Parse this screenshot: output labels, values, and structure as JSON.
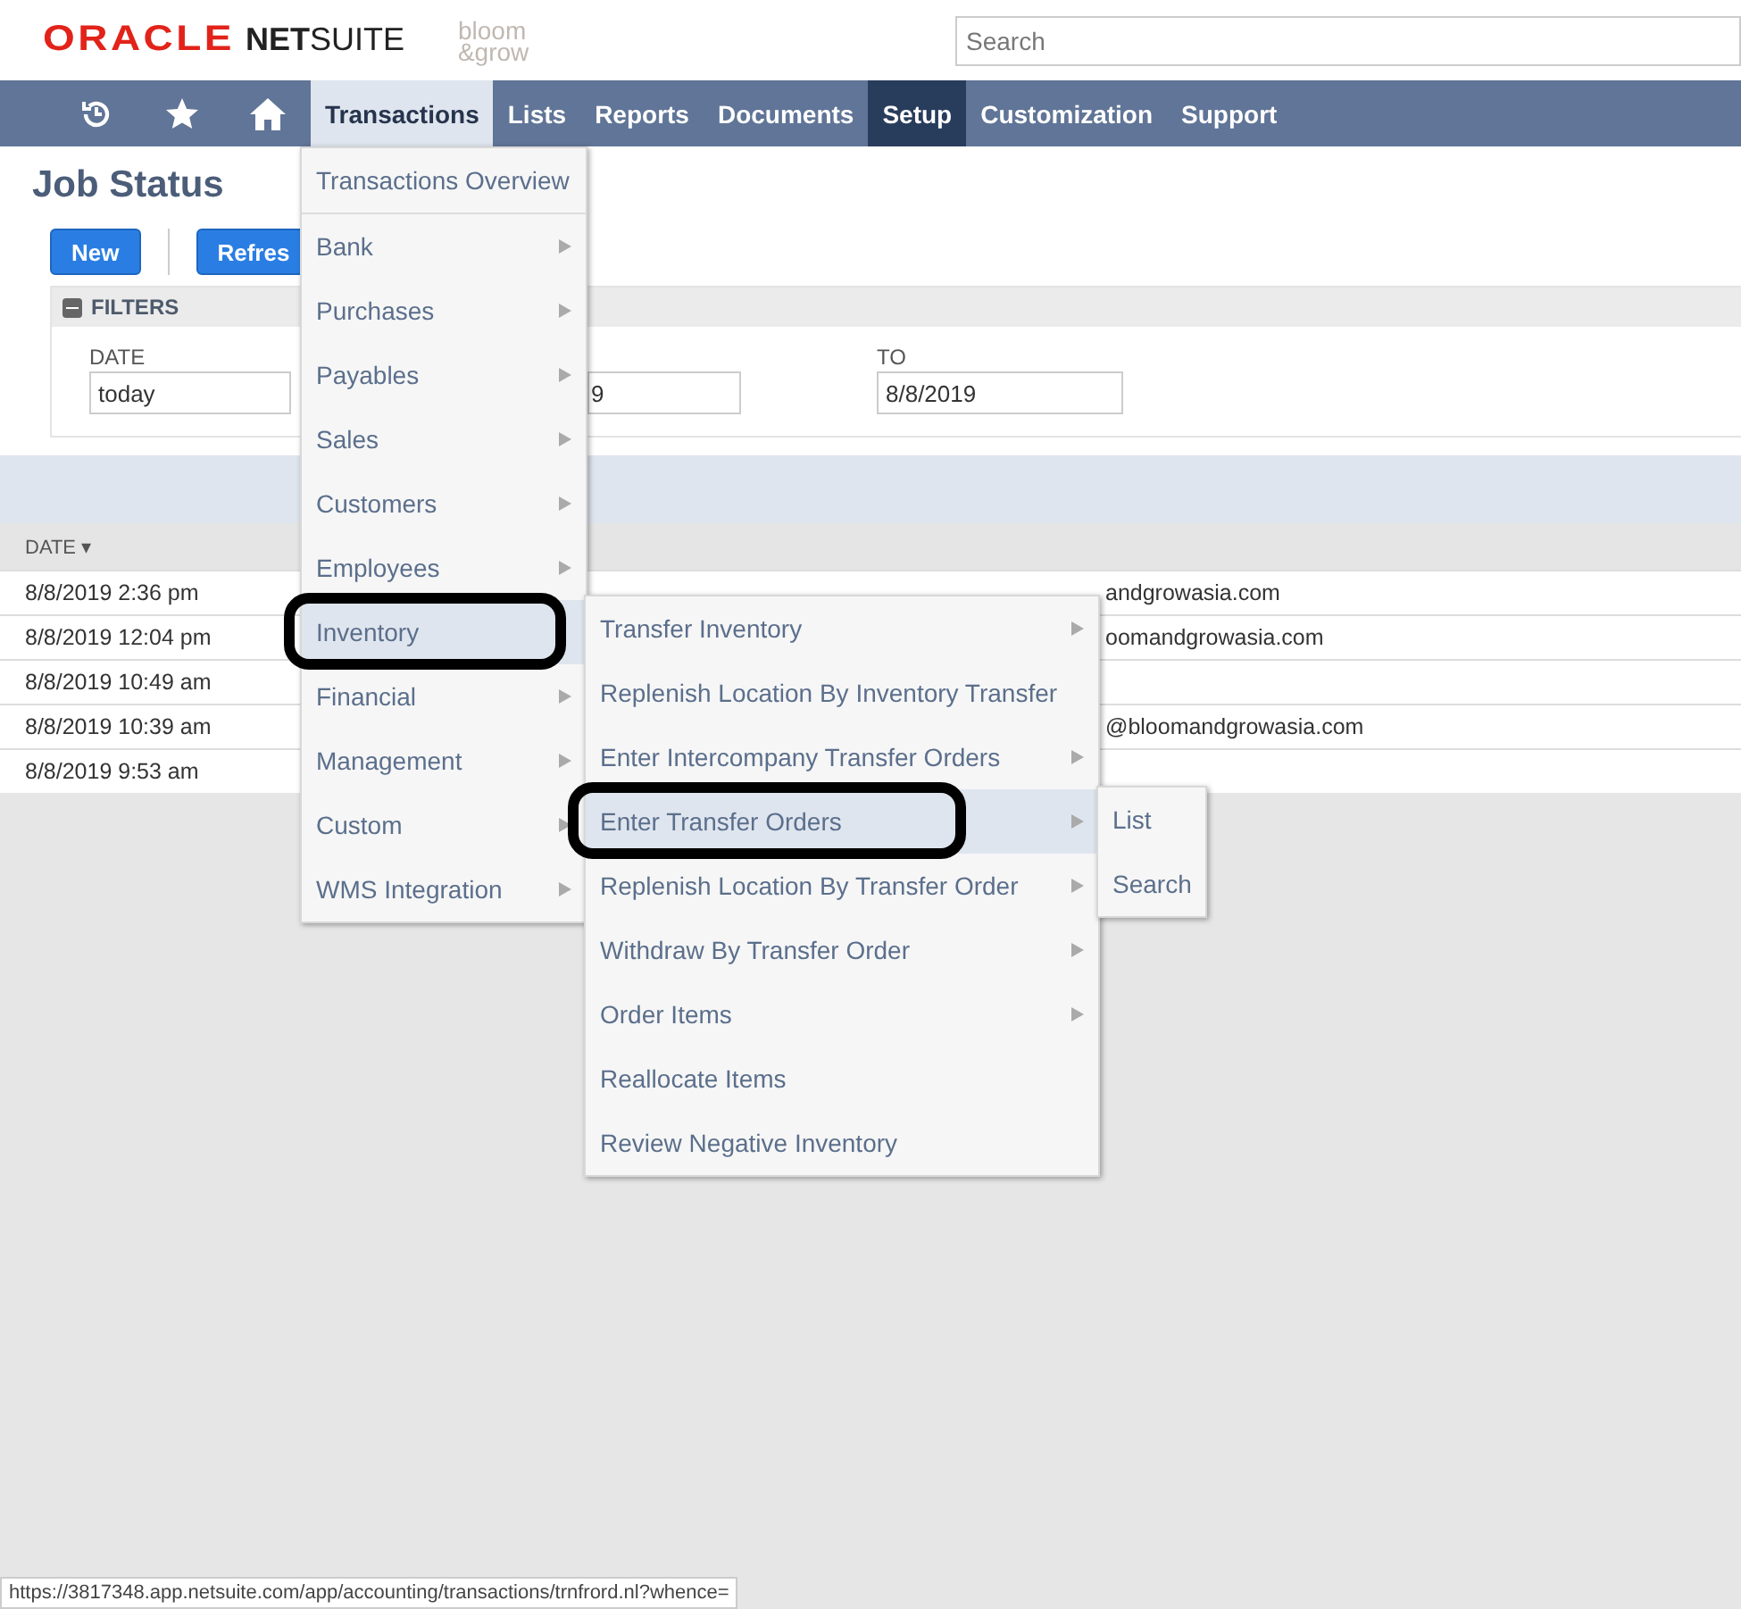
{
  "header": {
    "brand": {
      "oracle": "ORACLE",
      "netsuite": "**NET**SUITE"
    },
    "partner_logo": [
      "bloom",
      "&grow"
    ],
    "search": {
      "placeholder": "Search"
    }
  },
  "nav": {
    "tabs": [
      {
        "label": "Transactions",
        "open": true,
        "selected": false
      },
      {
        "label": "Lists",
        "open": false,
        "selected": false
      },
      {
        "label": "Reports",
        "open": false,
        "selected": false
      },
      {
        "label": "Documents",
        "open": false,
        "selected": false
      },
      {
        "label": "Setup",
        "open": false,
        "selected": true
      },
      {
        "label": "Customization",
        "open": false,
        "selected": false
      },
      {
        "label": "Support",
        "open": false,
        "selected": false
      }
    ]
  },
  "page": {
    "title": "Job Status",
    "buttons": [
      "New",
      "Refres"
    ]
  },
  "filters": {
    "title": "FILTERS",
    "fields": [
      {
        "label": "DATE",
        "value": "today"
      },
      {
        "value": "9"
      },
      {
        "label": "TO",
        "value": "8/8/2019"
      }
    ]
  },
  "table": {
    "columns": [
      "DATE ▾"
    ],
    "rows": [
      {
        "date": "8/8/2019 2:36 pm",
        "column_2": "andgrowasia.com"
      },
      {
        "date": "8/8/2019 12:04 pm",
        "column_2": "oomandgrowasia.com"
      },
      {
        "date": "8/8/2019 10:49 am"
      },
      {
        "date": "8/8/2019 10:39 am",
        "column_2": "@bloomandgrowasia.com"
      },
      {
        "date": "8/8/2019 9:53 am"
      }
    ]
  },
  "menus": [
    {
      "items": [
        {
          "label": "Transactions Overview",
          "submenu": false,
          "highlighted": false,
          "circled": false,
          "separator": true
        },
        {
          "label": "Bank",
          "submenu": true,
          "highlighted": false,
          "circled": false,
          "separator": false
        },
        {
          "label": "Purchases",
          "submenu": true,
          "highlighted": false,
          "circled": false,
          "separator": false
        },
        {
          "label": "Payables",
          "submenu": true,
          "highlighted": false,
          "circled": false,
          "separator": false
        },
        {
          "label": "Sales",
          "submenu": true,
          "highlighted": false,
          "circled": false,
          "separator": false
        },
        {
          "label": "Customers",
          "submenu": true,
          "highlighted": false,
          "circled": false,
          "separator": false
        },
        {
          "label": "Employees",
          "submenu": true,
          "highlighted": false,
          "circled": false,
          "separator": false
        },
        {
          "label": "Inventory",
          "submenu": false,
          "highlighted": true,
          "circled": true,
          "separator": false
        },
        {
          "label": "Financial",
          "submenu": true,
          "highlighted": false,
          "circled": false,
          "separator": false
        },
        {
          "label": "Management",
          "submenu": true,
          "highlighted": false,
          "circled": false,
          "separator": false
        },
        {
          "label": "Custom",
          "submenu": true,
          "highlighted": false,
          "circled": false,
          "separator": false
        },
        {
          "label": "WMS Integration",
          "submenu": true,
          "highlighted": false,
          "circled": false,
          "separator": false
        }
      ]
    },
    {
      "items": [
        {
          "label": "Transfer Inventory",
          "submenu": true,
          "highlighted": false,
          "circled": false,
          "separator": false
        },
        {
          "label": "Replenish Location By Inventory Transfer",
          "submenu": false,
          "highlighted": false,
          "circled": false,
          "separator": false
        },
        {
          "label": "Enter Intercompany Transfer Orders",
          "submenu": true,
          "highlighted": false,
          "circled": false,
          "separator": false
        },
        {
          "label": "Enter Transfer Orders",
          "submenu": true,
          "highlighted": true,
          "circled": true,
          "separator": false
        },
        {
          "label": "Replenish Location By Transfer Order",
          "submenu": true,
          "highlighted": false,
          "circled": false,
          "separator": false
        },
        {
          "label": "Withdraw By Transfer Order",
          "submenu": true,
          "highlighted": false,
          "circled": false,
          "separator": false
        },
        {
          "label": "Order Items",
          "submenu": true,
          "highlighted": false,
          "circled": false,
          "separator": false
        },
        {
          "label": "Reallocate Items",
          "submenu": false,
          "highlighted": false,
          "circled": false,
          "separator": false
        },
        {
          "label": "Review Negative Inventory",
          "submenu": false,
          "highlighted": false,
          "circled": false,
          "separator": false
        }
      ]
    },
    {
      "items": [
        {
          "label": "List",
          "submenu": false,
          "highlighted": false,
          "circled": false,
          "separator": false
        },
        {
          "label": "Search",
          "submenu": false,
          "highlighted": false,
          "circled": false,
          "separator": false
        }
      ]
    }
  ],
  "status_bar": {
    "url": "https://3817348.app.netsuite.com/app/accounting/transactions/trnfrord.nl?whence="
  }
}
